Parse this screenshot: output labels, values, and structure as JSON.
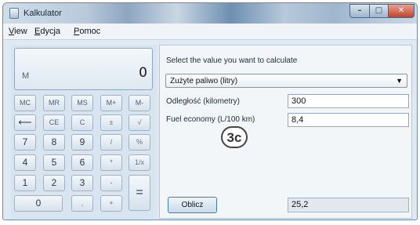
{
  "window": {
    "title": "Kalkulator",
    "controls": {
      "minimize": "–",
      "maximize": "□",
      "close": "✕"
    }
  },
  "menu": {
    "items": [
      {
        "label": "View",
        "underline": "V",
        "rest": "iew"
      },
      {
        "label": "Edycja",
        "underline": "E",
        "rest": "dycja"
      },
      {
        "label": "Pomoc",
        "underline": "P",
        "rest": "omoc"
      }
    ]
  },
  "calculator": {
    "memory_indicator": "M",
    "display_value": "0",
    "keys": {
      "mc": "MC",
      "mr": "MR",
      "ms": "MS",
      "mplus": "M+",
      "mminus": "M-",
      "backspace": "⟵",
      "ce": "CE",
      "c": "C",
      "plusminus": "±",
      "sqrt": "√",
      "seven": "7",
      "eight": "8",
      "nine": "9",
      "divide": "/",
      "percent": "%",
      "four": "4",
      "five": "5",
      "six": "6",
      "multiply": "*",
      "reciprocal": "1/x",
      "one": "1",
      "two": "2",
      "three": "3",
      "minus": "-",
      "equals": "=",
      "zero": "0",
      "decimal": ",",
      "plus": "+"
    }
  },
  "converter": {
    "prompt": "Select the value you want to calculate",
    "selected_option": "Zużyte paliwo (litry)",
    "fields": {
      "distance_label": "Odległość (kilometry)",
      "distance_value": "300",
      "economy_label": "Fuel economy (L/100 km)",
      "economy_value": "8,4"
    },
    "step_badge": "3c",
    "calculate_button": "Oblicz",
    "result_value": "25,2"
  }
}
